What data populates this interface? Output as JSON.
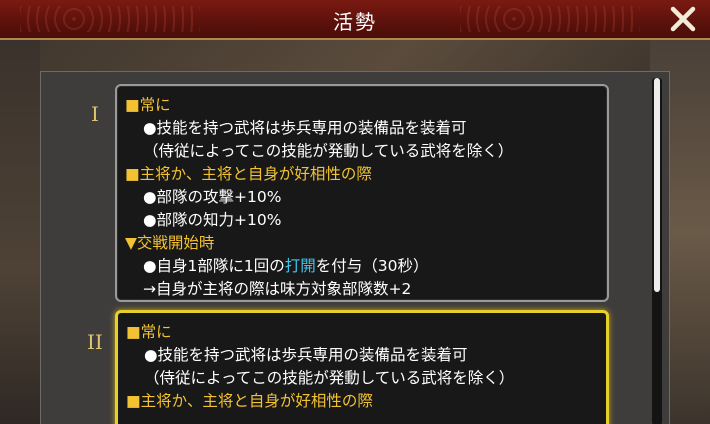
{
  "header": {
    "title": "活勢"
  },
  "sections": [
    {
      "numeral": "I",
      "lines": [
        {
          "kind": "head",
          "text": "■常に"
        },
        {
          "kind": "sub",
          "text": "●技能を持つ武将は歩兵専用の装備品を装着可"
        },
        {
          "kind": "sub",
          "text": "（侍従によってこの技能が発動している武将を除く）"
        },
        {
          "kind": "head",
          "text": "■主将か、主将と自身が好相性の際"
        },
        {
          "kind": "sub",
          "text": "●部隊の攻撃+10%"
        },
        {
          "kind": "sub",
          "text": "●部隊の知力+10%"
        },
        {
          "kind": "head",
          "text": "▼交戦開始時"
        },
        {
          "kind": "sub",
          "pre": "●自身1部隊に1回の",
          "hl": "打開",
          "post": "を付与（30秒）"
        },
        {
          "kind": "sub",
          "text": "→自身が主将の際は味方対象部隊数+2"
        }
      ]
    },
    {
      "numeral": "II",
      "lines": [
        {
          "kind": "head",
          "text": "■常に"
        },
        {
          "kind": "sub",
          "text": "●技能を持つ武将は歩兵専用の装備品を装着可"
        },
        {
          "kind": "sub",
          "text": "（侍従によってこの技能が発動している武将を除く）"
        },
        {
          "kind": "head",
          "text": "■主将か、主将と自身が好相性の際"
        }
      ]
    }
  ],
  "colors": {
    "heading": "#f2c232",
    "keyword": "#3ec6f0",
    "selected_border": "#e7cf2c"
  },
  "icons": {
    "close": "close-icon"
  }
}
